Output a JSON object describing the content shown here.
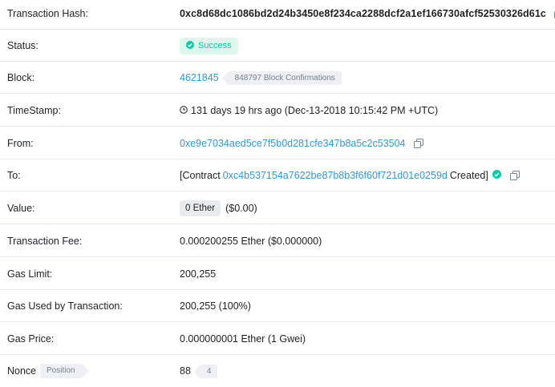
{
  "tx_hash": {
    "label": "Transaction Hash:",
    "value": "0xc8d68dc1086bd2d24b3450e8f234ca2288dcf2a1ef166730afcf52530326d61c"
  },
  "status": {
    "label": "Status:",
    "value": "Success"
  },
  "block": {
    "label": "Block:",
    "number": "4621845",
    "confirmations": "848797 Block Confirmations"
  },
  "timestamp": {
    "label": "TimeStamp:",
    "value": "131 days 19 hrs ago (Dec-13-2018 10:15:42 PM +UTC)"
  },
  "from": {
    "label": "From:",
    "address": "0xe9e7034aed5ce7f5b0d281cfe347b8a5c2c53504"
  },
  "to": {
    "label": "To:",
    "prefix": "[Contract",
    "address": "0xc4b537154a7622be87b8b3f6f60f721d01e0259d",
    "suffix": "Created]"
  },
  "value": {
    "label": "Value:",
    "ether": "0 Ether",
    "usd": "($0.00)"
  },
  "tx_fee": {
    "label": "Transaction Fee:",
    "value": "0.000200255 Ether ($0.000000)"
  },
  "gas_limit": {
    "label": "Gas Limit:",
    "value": "200,255"
  },
  "gas_used": {
    "label": "Gas Used by Transaction:",
    "value": "200,255 (100%)"
  },
  "gas_price": {
    "label": "Gas Price:",
    "value": "0.000000001 Ether (1 Gwei)"
  },
  "nonce": {
    "label": "Nonce",
    "position_tag": "Position",
    "value": "88",
    "position": "4"
  },
  "colors": {
    "link": "#3498db",
    "success": "#00c9a7",
    "success_bg": "#def7ed",
    "separator": "#e7eaf3"
  },
  "icons": [
    "copy-icon",
    "check-circle-icon",
    "clock-icon",
    "verified-check-icon"
  ]
}
